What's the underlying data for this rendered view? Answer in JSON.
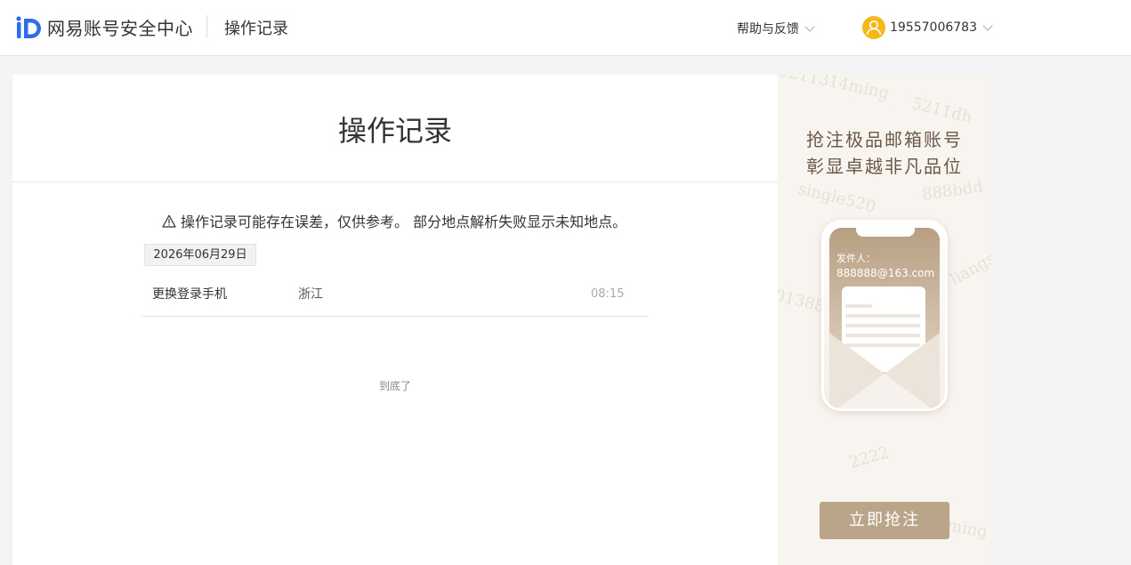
{
  "header": {
    "brand": "网易账号安全中心",
    "section": "操作记录",
    "help_label": "帮助与反馈",
    "user_phone": "19557006783"
  },
  "main": {
    "title": "操作记录",
    "notice": "操作记录可能存在误差，仅供参考。 部分地点解析失败显示未知地点。",
    "date": "2026年06月29日",
    "records": [
      {
        "action": "更换登录手机",
        "location": "浙江",
        "time": "08:15"
      }
    ],
    "end_text": "到底了"
  },
  "ad": {
    "slogan_line1": "抢注极品邮箱账号",
    "slogan_line2": "彰显卓越非凡品位",
    "sender_label": "发件人：",
    "sender_email": "888888@163.com",
    "button_label": "立即抢注",
    "watermarks": [
      "5211314ming",
      "5211dh",
      "single520",
      "888bdd",
      "01388",
      "liangs",
      "2222",
      "ming"
    ]
  },
  "colors": {
    "brand_blue": "#2d6ee8",
    "avatar_yellow": "#f5b81a",
    "ad_bg": "#f8f4f0",
    "ad_button": "#bba58a",
    "ad_text": "#6e5846"
  }
}
